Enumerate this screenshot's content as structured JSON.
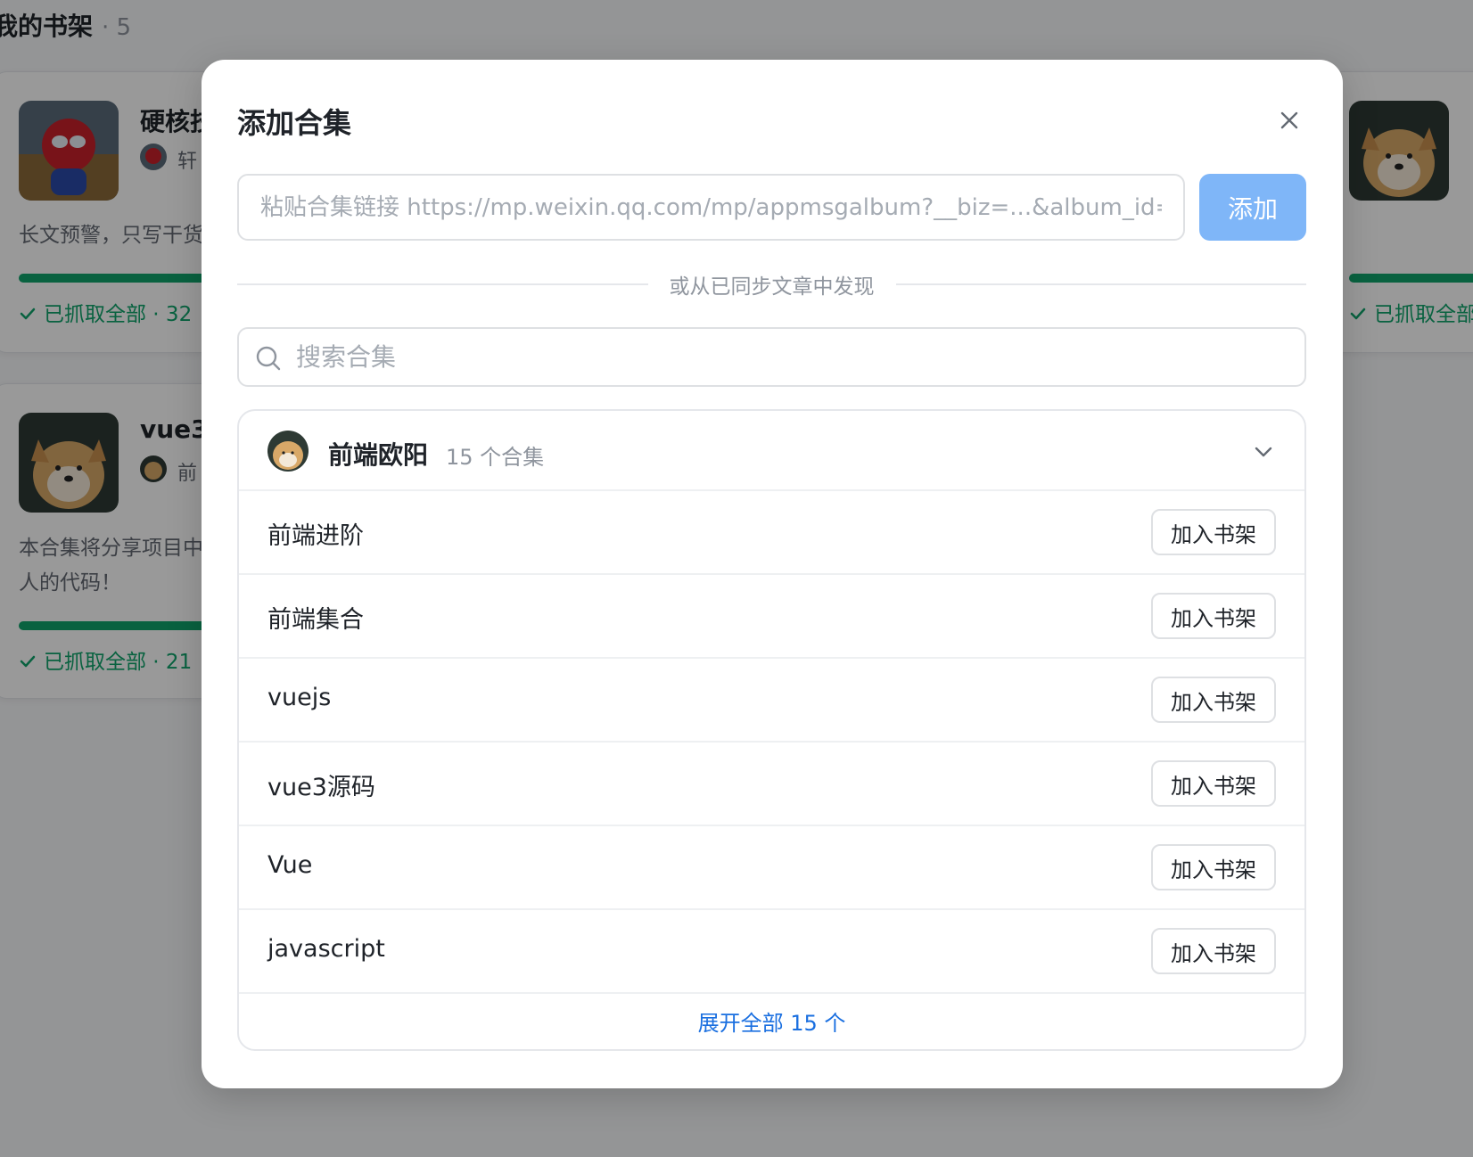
{
  "shelf": {
    "title": "我的书架",
    "count": "· 5"
  },
  "background_cards": [
    {
      "title": "硬核技",
      "author": "轩",
      "description": "长文预警，只写干货",
      "status": "已抓取全部 · 32"
    },
    {
      "title": "vue3",
      "author": "前",
      "description_line1": "本合集将分享项目中",
      "description_line2": "人的代码！",
      "status": "已抓取全部 · 21"
    },
    {
      "status": "已抓取全部"
    }
  ],
  "modal": {
    "title": "添加合集",
    "url_placeholder": "粘贴合集链接 https://mp.weixin.qq.com/mp/appmsgalbum?__biz=...&album_id=",
    "add_label": "添加",
    "divider_text": "或从已同步文章中发现",
    "search_placeholder": "搜索合集",
    "account": {
      "name": "前端欧阳",
      "album_count": "15 个合集"
    },
    "albums": [
      {
        "name": "前端进阶",
        "action": "加入书架"
      },
      {
        "name": "前端集合",
        "action": "加入书架"
      },
      {
        "name": "vuejs",
        "action": "加入书架"
      },
      {
        "name": "vue3源码",
        "action": "加入书架"
      },
      {
        "name": "Vue",
        "action": "加入书架"
      },
      {
        "name": "javascript",
        "action": "加入书架"
      }
    ],
    "expand_label": "展开全部 15 个"
  },
  "colors": {
    "accent": "#1a6fe0",
    "add_button": "#7fb6f8",
    "success": "#10a36b"
  },
  "icons": {
    "close": "close-icon",
    "search": "search-icon",
    "chevron": "chevron-down-icon",
    "check": "check-icon"
  }
}
